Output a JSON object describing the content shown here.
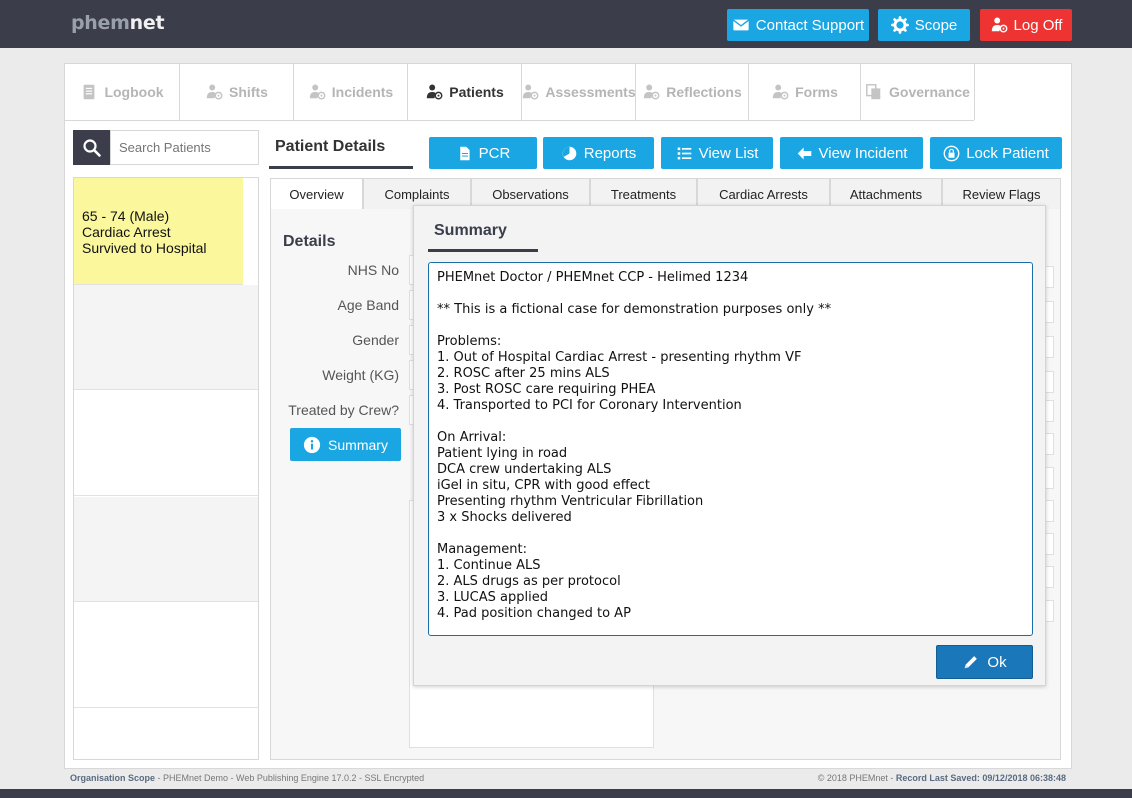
{
  "app": {
    "logo_part1": "phem",
    "logo_part2": "net"
  },
  "topbar": {
    "contact_label": "Contact Support",
    "scope_label": "Scope",
    "logoff_label": "Log Off"
  },
  "nav": {
    "tabs": [
      {
        "label": "Logbook",
        "icon": "book-icon"
      },
      {
        "label": "Shifts",
        "icon": "user-gear-icon"
      },
      {
        "label": "Incidents",
        "icon": "user-gear-icon"
      },
      {
        "label": "Patients",
        "icon": "user-gear-icon",
        "active": true
      },
      {
        "label": "Assessments",
        "icon": "user-gear-icon"
      },
      {
        "label": "Reflections",
        "icon": "user-gear-icon"
      },
      {
        "label": "Forms",
        "icon": "user-gear-icon"
      },
      {
        "label": "Governance",
        "icon": "copy-icon"
      }
    ]
  },
  "search": {
    "placeholder": "Search Patients"
  },
  "patients": [
    {
      "line1": "65 - 74 (Male)",
      "line2": "Cardiac Arrest",
      "line3": "Survived to Hospital",
      "selected": true
    }
  ],
  "patient": {
    "title": "Patient Details"
  },
  "actions": {
    "pcr": "PCR",
    "reports": "Reports",
    "view_list": "View List",
    "view_incident": "View Incident",
    "lock_patient": "Lock Patient"
  },
  "subtabs": {
    "overview": "Overview",
    "complaints": "Complaints",
    "observations": "Observations",
    "treatments": "Treatments",
    "cardiac_arrests": "Cardiac Arrests",
    "attachments": "Attachments",
    "review_flags": "Review Flags"
  },
  "details": {
    "heading": "Details",
    "nhs_no": "NHS No",
    "age_band": "Age Band",
    "gender": "Gender",
    "weight": "Weight (KG)",
    "treated_by_crew": "Treated by Crew?",
    "summary_button": "Summary"
  },
  "modal": {
    "title": "Summary",
    "text": "PHEMnet Doctor / PHEMnet CCP - Helimed 1234\n\n** This is a fictional case for demonstration purposes only **\n\nProblems:\n1. Out of Hospital Cardiac Arrest - presenting rhythm VF\n2. ROSC after 25 mins ALS\n3. Post ROSC care requiring PHEA\n4. Transported to PCI for Coronary Intervention\n\nOn Arrival:\nPatient lying in road\nDCA crew undertaking ALS\niGel in situ, CPR with good effect\nPresenting rhythm Ventricular Fibrillation\n3 x Shocks delivered\n\nManagement:\n1. Continue ALS\n2. ALS drugs as per protocol\n3. LUCAS applied\n4. Pad position changed to AP",
    "ok_label": "Ok"
  },
  "footer": {
    "left_bold": "Organisation Scope",
    "left_text": " - PHEMnet Demo - Web Publishing Engine 17.0.2 - SSL Encrypted",
    "right_prefix": "© 2018 PHEMnet - ",
    "right_bold": "Record Last Saved: 09/12/2018 06:38:48"
  },
  "colors": {
    "primary": "#1aa6e2",
    "danger": "#ee3333",
    "header": "#3b3e4a",
    "ok": "#1a78ba",
    "highlight": "#fbf79c"
  }
}
